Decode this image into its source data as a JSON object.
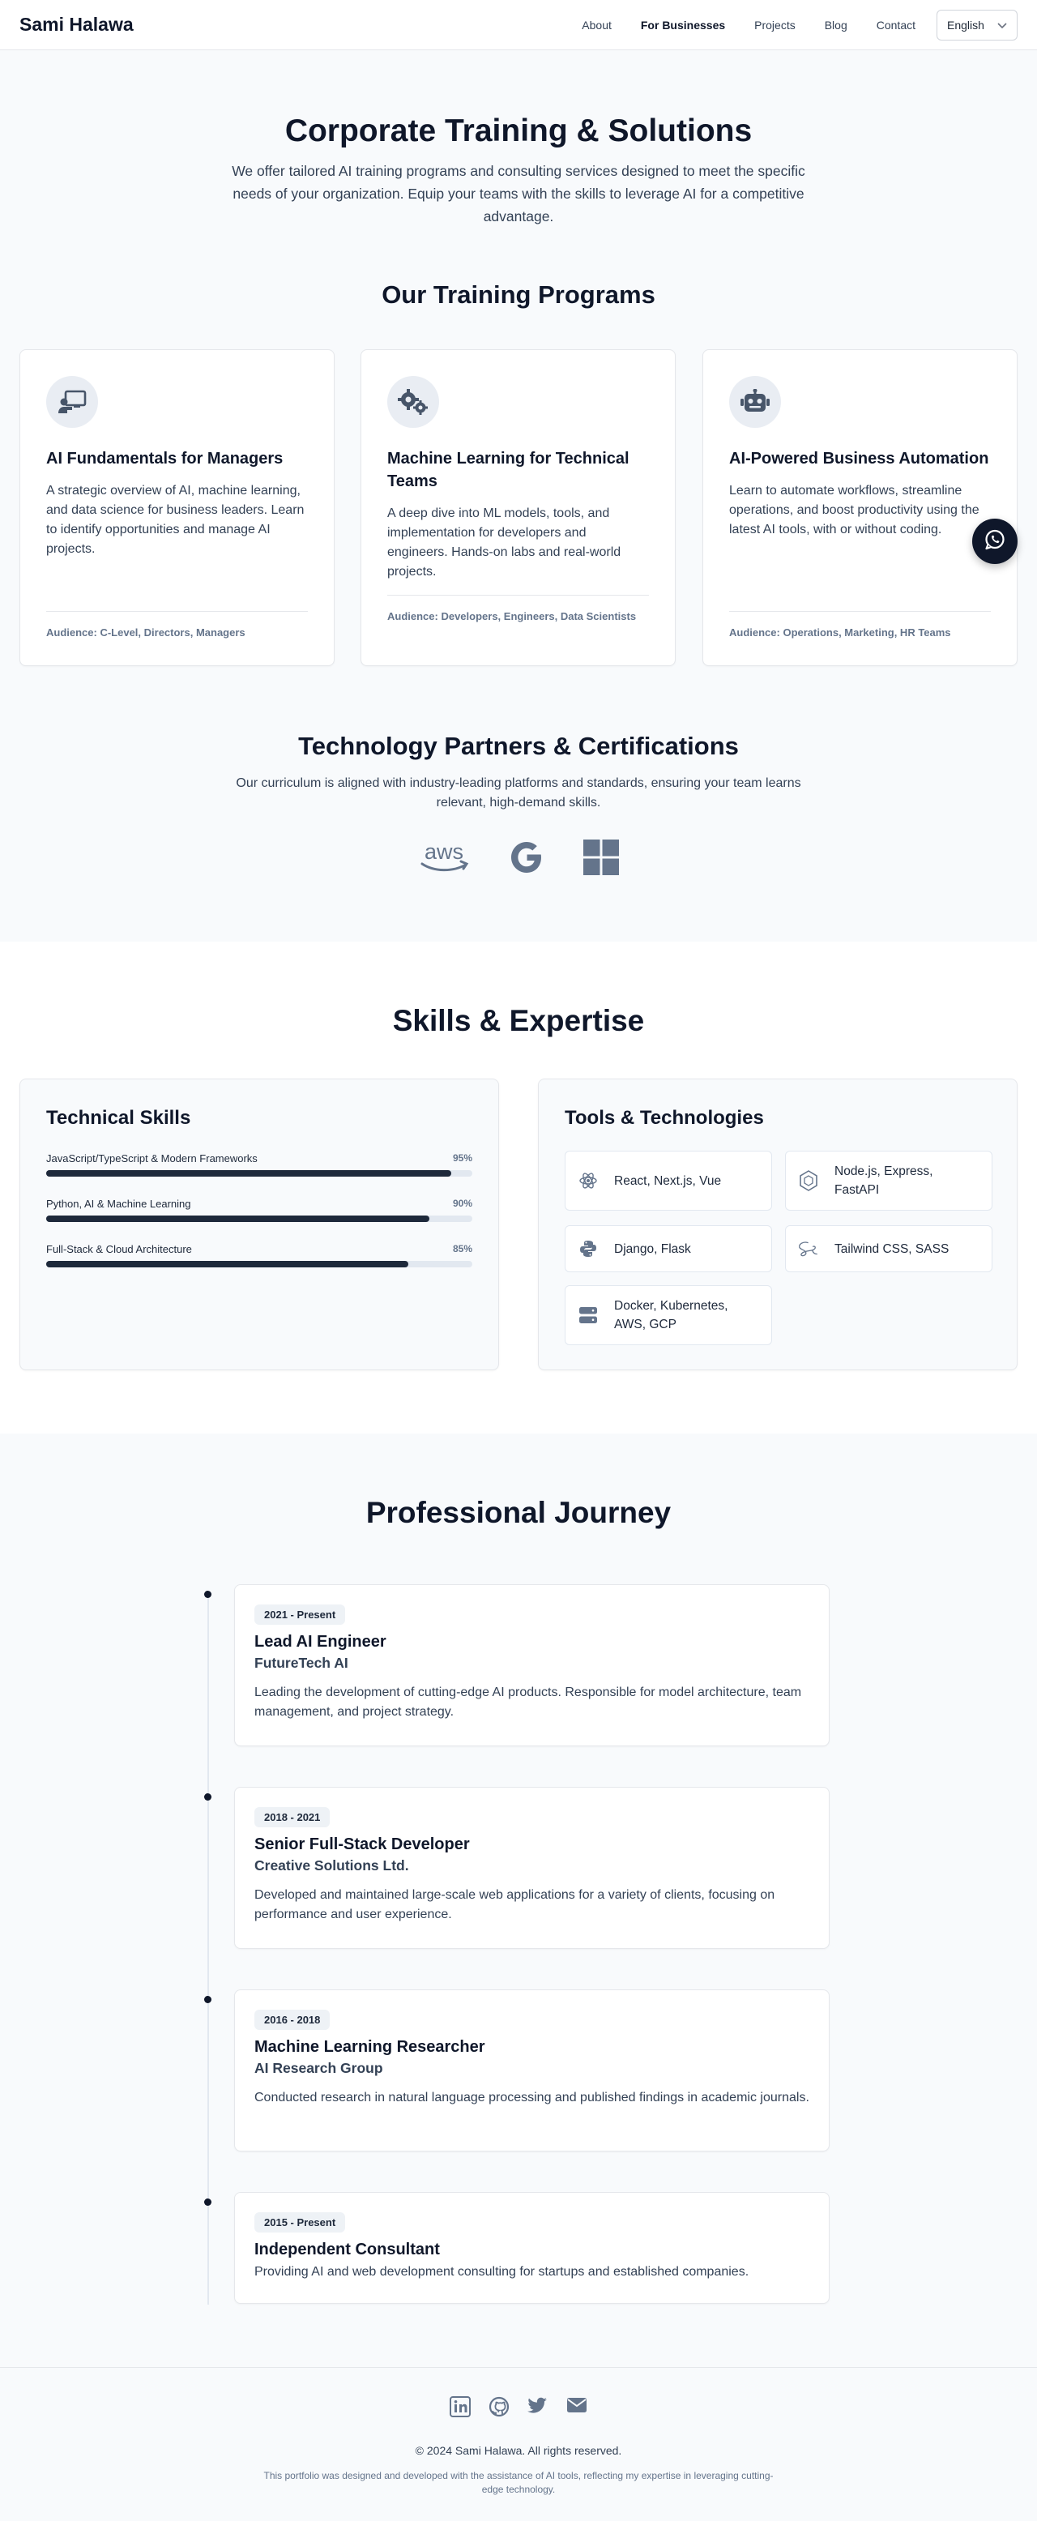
{
  "header": {
    "logo": "Sami Halawa",
    "nav": [
      "About",
      "For Businesses",
      "Projects",
      "Blog",
      "Contact"
    ],
    "language": "English"
  },
  "hero": {
    "title": "Corporate Training & Solutions",
    "subtitle": "We offer tailored AI training programs and consulting services designed to meet the specific needs of your organization. Equip your teams with the skills to leverage AI for a competitive advantage."
  },
  "programs": {
    "title": "Our Training Programs",
    "items": [
      {
        "icon": "chalkboard-teacher-icon",
        "title": "AI Fundamentals for Managers",
        "description": "A strategic overview of AI, machine learning, and data science for business leaders. Learn to identify opportunities and manage AI projects.",
        "audience": "Audience: C-Level, Directors, Managers"
      },
      {
        "icon": "gears-icon",
        "title": "Machine Learning for Technical Teams",
        "description": "A deep dive into ML models, tools, and implementation for developers and engineers. Hands-on labs and real-world projects.",
        "audience": "Audience: Developers, Engineers, Data Scientists"
      },
      {
        "icon": "robot-icon",
        "title": "AI-Powered Business Automation",
        "description": "Learn to automate workflows, streamline operations, and boost productivity using the latest AI tools, with or without coding.",
        "audience": "Audience: Operations, Marketing, HR Teams"
      }
    ]
  },
  "partners": {
    "title": "Technology Partners & Certifications",
    "subtitle": "Our curriculum is aligned with industry-leading platforms and standards, ensuring your team learns relevant, high-demand skills.",
    "logos": [
      "aws-logo",
      "google-logo",
      "microsoft-logo"
    ],
    "aws_text": "aws"
  },
  "skills": {
    "title": "Skills & Expertise",
    "technical": {
      "title": "Technical Skills",
      "items": [
        {
          "label": "JavaScript/TypeScript & Modern Frameworks",
          "percent": "95%",
          "value": 95
        },
        {
          "label": "Python, AI & Machine Learning",
          "percent": "90%",
          "value": 90
        },
        {
          "label": "Full-Stack & Cloud Architecture",
          "percent": "85%",
          "value": 85
        }
      ]
    },
    "tools": {
      "title": "Tools & Technologies",
      "items": [
        {
          "icon": "react-icon",
          "label": "React, Next.js, Vue"
        },
        {
          "icon": "nodejs-icon",
          "label": "Node.js, Express, FastAPI"
        },
        {
          "icon": "python-icon",
          "label": "Django, Flask"
        },
        {
          "icon": "sass-icon",
          "label": "Tailwind CSS, SASS"
        },
        {
          "icon": "server-icon",
          "label": "Docker, Kubernetes, AWS, GCP"
        }
      ]
    }
  },
  "journey": {
    "title": "Professional Journey",
    "items": [
      {
        "period": "2021 - Present",
        "role": "Lead AI Engineer",
        "company": "FutureTech AI",
        "description": "Leading the development of cutting-edge AI products. Responsible for model architecture, team management, and project strategy."
      },
      {
        "period": "2018 - 2021",
        "role": "Senior Full-Stack Developer",
        "company": "Creative Solutions Ltd.",
        "description": "Developed and maintained large-scale web applications for a variety of clients, focusing on performance and user experience."
      },
      {
        "period": "2016 - 2018",
        "role": "Machine Learning Researcher",
        "company": "AI Research Group",
        "description": "Conducted research in natural language processing and published findings in academic journals."
      },
      {
        "period": "2015 - Present",
        "role": "Independent Consultant",
        "company": "",
        "description": "Providing AI and web development consulting for startups and established companies."
      }
    ]
  },
  "footer": {
    "social": [
      "linkedin-icon",
      "github-icon",
      "twitter-icon",
      "mail-icon"
    ],
    "copyright": "© 2024 Sami Halawa. All rights reserved.",
    "note": "This portfolio was designed and developed with the assistance of AI tools, reflecting my expertise in leveraging cutting-edge technology."
  },
  "colors": {
    "primary": "#0f172a",
    "muted": "#64748b",
    "icon": "#64748b",
    "bar": "#1e293b"
  }
}
